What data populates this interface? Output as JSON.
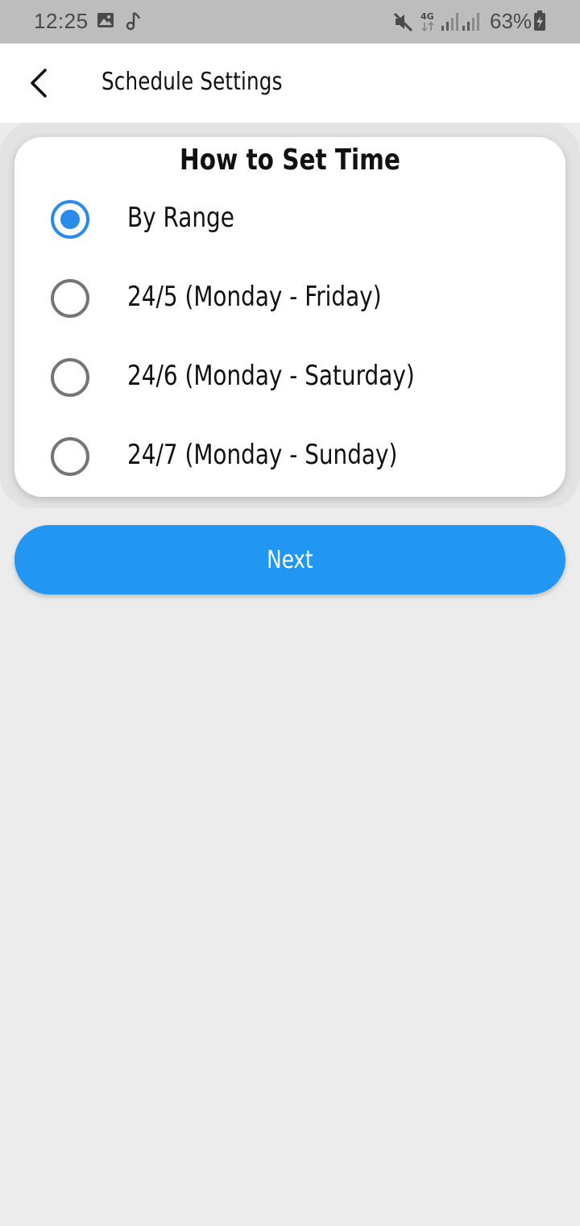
{
  "status_bar": {
    "time": "12:25",
    "battery_percent": "63%",
    "network": "4G",
    "icons": [
      "image-icon",
      "music-note-icon",
      "mute-icon",
      "network-4g-icon",
      "signal-icon",
      "signal-icon",
      "battery-charging-icon"
    ]
  },
  "app_bar": {
    "title": "Schedule Settings",
    "back_icon": "chevron-left-icon"
  },
  "card": {
    "title": "How to Set Time",
    "options": [
      {
        "label": "By Range",
        "selected": true
      },
      {
        "label": "24/5 (Monday - Friday)",
        "selected": false
      },
      {
        "label": "24/6 (Monday - Saturday)",
        "selected": false
      },
      {
        "label": "24/7 (Monday - Sunday)",
        "selected": false
      }
    ]
  },
  "next_button": {
    "label": "Next"
  },
  "colors": {
    "accent": "#2196f3",
    "radio_selected": "#2a8bea",
    "radio_unselected": "#757575",
    "background": "#ececec",
    "status_bar": "#bdbdbd"
  }
}
